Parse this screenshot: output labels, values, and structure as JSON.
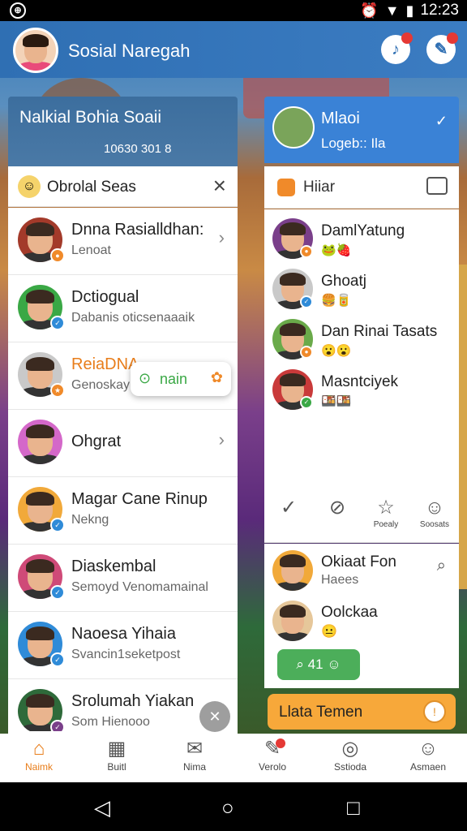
{
  "status": {
    "time": "12:23"
  },
  "appbar": {
    "title": "Sosial Naregah"
  },
  "left": {
    "header_title": "Nalkial Bohia Soaii",
    "header_sub": "10630 301 8",
    "search_label": "Obrolal Seas",
    "rows": [
      {
        "name": "Dnna Rasialldhan:",
        "sub": "Lenoat",
        "bg": "#a33a2a",
        "mini": "#f08a2a"
      },
      {
        "name": "Dctiogual",
        "sub": "Dabanis oticsenaaaik",
        "bg": "#3aa845",
        "mini": "#2f8bd8"
      },
      {
        "name": "ReiaDNA",
        "sub": "Genoskay",
        "bg": "#c9c9c9",
        "mini": "#f08a2a",
        "accent": true
      },
      {
        "name": "Ohgrat",
        "sub": "",
        "bg": "#d468c9",
        "mini": ""
      },
      {
        "name": "Magar Cane Rinup",
        "sub": "Nekng",
        "bg": "#f1a93a",
        "mini": "#2f8bd8"
      },
      {
        "name": "Diaskembal",
        "sub": "Semoyd Venomamainal",
        "bg": "#cf4a78",
        "mini": "#2f8bd8"
      },
      {
        "name": "Naoesa Yihaia",
        "sub": "Svancin1seketpost",
        "bg": "#2f8bd8",
        "mini": "#2f8bd8"
      },
      {
        "name": "Srolumah Yiakan",
        "sub": "Som Hienooo",
        "bg": "#2e6a3a",
        "mini": "#7a3f8a"
      }
    ],
    "toast": "nain"
  },
  "right": {
    "header_title": "Mlaoi",
    "header_sub": "Logeb:: Ila",
    "sub_label": "Hiiar",
    "rows": [
      {
        "name": "DamlYatung",
        "emo": "🐸🍓",
        "bg": "#7a3f8a",
        "mini": "#f08a2a"
      },
      {
        "name": "Ghoatj",
        "emo": "🍔🥫",
        "bg": "#c9c9c9",
        "mini": "#2f8bd8"
      },
      {
        "name": "Dan Rinai Tasats",
        "emo": "😮😮",
        "bg": "#6aaa4a",
        "mini": "#f08a2a"
      },
      {
        "name": "Masntciyek",
        "emo": "🍱🍱",
        "bg": "#c93a3a",
        "mini": "#3aa845"
      }
    ],
    "actions": [
      {
        "icon": "✓",
        "label": ""
      },
      {
        "icon": "⊘",
        "label": ""
      },
      {
        "icon": "☆",
        "label": "Poealy"
      },
      {
        "icon": "☺",
        "label": "Soosats"
      }
    ],
    "bottom_rows": [
      {
        "name": "Okiaat Fon",
        "sub": "Haees",
        "bg": "#f1a93a"
      },
      {
        "name": "Oolckaa",
        "sub": "😐",
        "bg": "#e6c79a"
      }
    ],
    "pill": "41",
    "cta": "Llata Temen"
  },
  "nav": [
    {
      "label": "Naimk",
      "icon": "⌂",
      "active": true
    },
    {
      "label": "Buitl",
      "icon": "▦",
      "active": false
    },
    {
      "label": "Nima",
      "icon": "✉",
      "active": false
    },
    {
      "label": "Verolo",
      "icon": "✎",
      "active": false,
      "badge": true
    },
    {
      "label": "Sstioda",
      "icon": "◎",
      "active": false
    },
    {
      "label": "Asmaen",
      "icon": "☺",
      "active": false
    }
  ]
}
